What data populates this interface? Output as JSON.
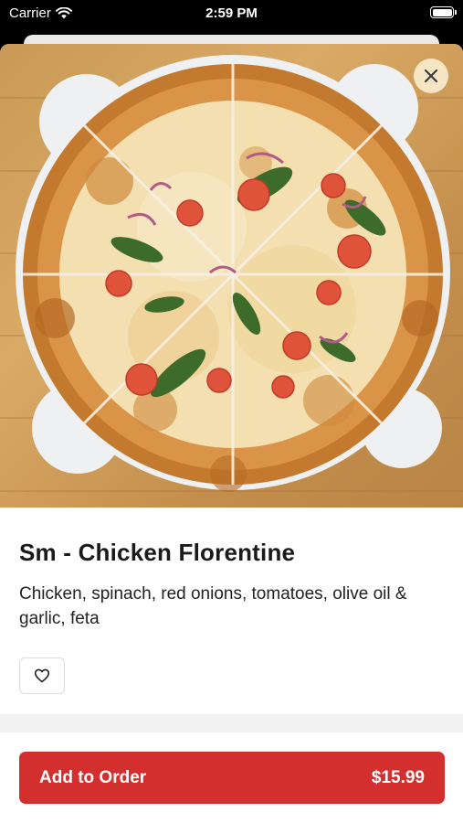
{
  "status_bar": {
    "carrier": "Carrier",
    "time": "2:59 PM"
  },
  "item": {
    "title": "Sm - Chicken Florentine",
    "description": "Chicken, spinach, red onions, tomatoes, olive oil & garlic, feta"
  },
  "footer": {
    "add_label": "Add to Order",
    "price": "$15.99"
  },
  "colors": {
    "accent": "#d32f2f",
    "close_bg": "#faebcd"
  },
  "icons": {
    "close": "close-icon",
    "favorite": "heart-icon",
    "wifi": "wifi-icon",
    "battery": "battery-icon"
  }
}
